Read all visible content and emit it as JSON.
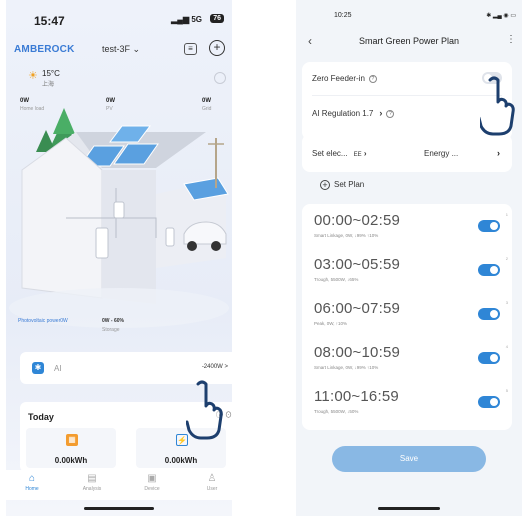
{
  "left": {
    "status": {
      "time": "15:47",
      "signal": "5G",
      "battery": "76"
    },
    "brand": "AMBEROCK",
    "device": "test-3F",
    "weather": {
      "temp": "15°C",
      "desc": "上海"
    },
    "power": {
      "home": {
        "value": "0W",
        "label": "Home load"
      },
      "pv": {
        "value": "0W",
        "label": "PV"
      },
      "grid": {
        "value": "0W",
        "label": "Grid"
      }
    },
    "pv_label": "Photovoltaic power0W",
    "storage": {
      "value": "0W - 60%",
      "label": "Storage"
    },
    "ai_card": {
      "label": "AI",
      "value": "-2400W"
    },
    "today": {
      "title": "Today",
      "items": [
        {
          "value": "0.00kWh",
          "icon": "solar-icon"
        },
        {
          "value": "0.00kWh",
          "icon": "grid-icon"
        }
      ]
    },
    "tabs": [
      {
        "label": "Home",
        "icon": "home-icon"
      },
      {
        "label": "Analysis",
        "icon": "analysis-icon"
      },
      {
        "label": "Device",
        "icon": "device-icon"
      },
      {
        "label": "User",
        "icon": "user-icon"
      }
    ]
  },
  "right": {
    "status": {
      "time": "10:25"
    },
    "title": "Smart Green Power Plan",
    "zero_feeder": "Zero Feeder-in",
    "ai_regulation": "AI Regulation 1.7",
    "set_elec": "Set elec...",
    "set_elec_suffix": "EE",
    "energy": "Energy ...",
    "set_plan": "Set Plan",
    "plans": [
      {
        "range": "00:00~02:59",
        "detail": "Smart Linkage, 0W, ↓99% ↑10%",
        "idx": "1",
        "enabled": true
      },
      {
        "range": "03:00~05:59",
        "detail": "Trough, 5500W, ↓65%",
        "idx": "2",
        "enabled": true
      },
      {
        "range": "06:00~07:59",
        "detail": "Peak, 0W, ↑10%",
        "idx": "3",
        "enabled": true
      },
      {
        "range": "08:00~10:59",
        "detail": "Smart Linkage, 0W, ↓99% ↑10%",
        "idx": "4",
        "enabled": true
      },
      {
        "range": "11:00~16:59",
        "detail": "Trough, 5500W, ↓50%",
        "idx": "5",
        "enabled": true
      }
    ],
    "save_label": "Save"
  }
}
